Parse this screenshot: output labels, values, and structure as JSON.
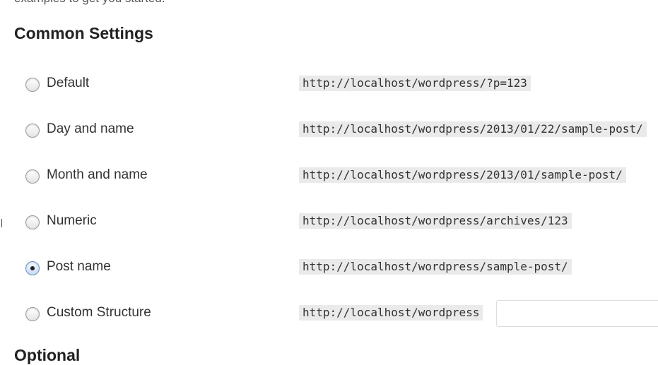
{
  "intro_text": "examples to get you started.",
  "section_title": "Common Settings",
  "next_section_title": "Optional",
  "options": [
    {
      "label": "Default",
      "example": "http://localhost/wordpress/?p=123",
      "checked": false
    },
    {
      "label": "Day and name",
      "example": "http://localhost/wordpress/2013/01/22/sample-post/",
      "checked": false
    },
    {
      "label": "Month and name",
      "example": "http://localhost/wordpress/2013/01/sample-post/",
      "checked": false
    },
    {
      "label": "Numeric",
      "example": "http://localhost/wordpress/archives/123",
      "checked": false
    },
    {
      "label": "Post name",
      "example": "http://localhost/wordpress/sample-post/",
      "checked": true
    },
    {
      "label": "Custom Structure",
      "example": "http://localhost/wordpress",
      "checked": false
    }
  ],
  "custom_structure": {
    "value": "",
    "placeholder": ""
  },
  "colors": {
    "code_background": "#eaeaea",
    "radio_checked_border": "#6a8fc4"
  }
}
